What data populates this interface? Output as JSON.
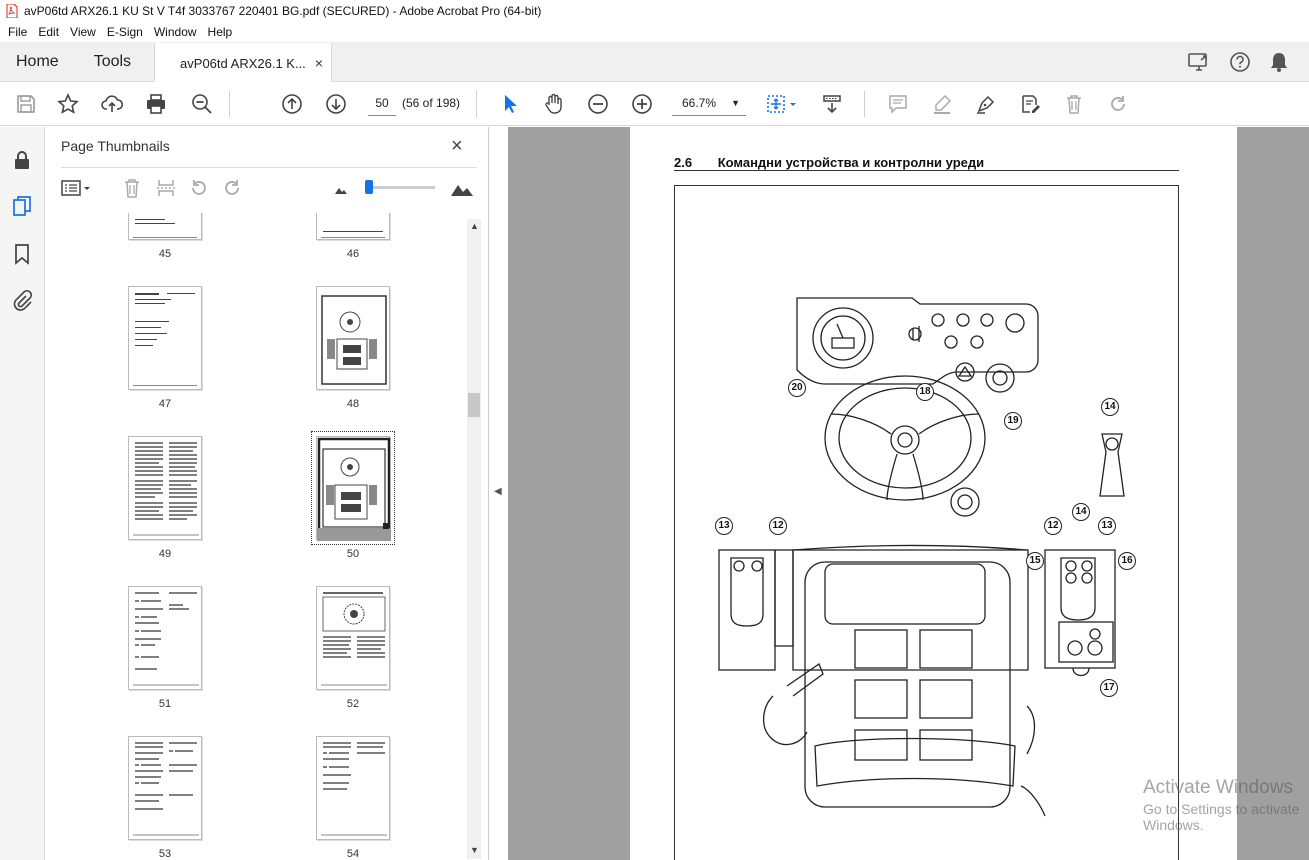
{
  "window": {
    "title": "avP06td ARX26.1 KU St V T4f 3033767 220401 BG.pdf (SECURED) - Adobe Acrobat Pro (64-bit)"
  },
  "menu": [
    "File",
    "Edit",
    "View",
    "E-Sign",
    "Window",
    "Help"
  ],
  "tabs": {
    "home": "Home",
    "tools": "Tools",
    "doc": "avP06td ARX26.1 K...",
    "close": "×"
  },
  "toolbar": {
    "page_value": "50",
    "page_count": "(56 of 198)",
    "zoom": "66.7%"
  },
  "panel": {
    "title": "Page Thumbnails",
    "close": "×",
    "thumbnails": [
      {
        "label": "45"
      },
      {
        "label": "46"
      },
      {
        "label": "47"
      },
      {
        "label": "48"
      },
      {
        "label": "49"
      },
      {
        "label": "50",
        "selected": true
      },
      {
        "label": "51"
      },
      {
        "label": "52"
      },
      {
        "label": "53"
      },
      {
        "label": "54"
      }
    ]
  },
  "document": {
    "section_number": "2.6",
    "section_title": "Командни устройства и контролни уреди",
    "callouts": [
      "20",
      "18",
      "19",
      "14",
      "13",
      "12",
      "12",
      "14",
      "13",
      "15",
      "16",
      "17"
    ]
  },
  "watermark": {
    "line1": "Activate Windows",
    "line2": "Go to Settings to activate Windows."
  },
  "colors": {
    "accent": "#1473e6",
    "pdf_red": "#d9241a",
    "doc_bg": "#a0a0a0"
  }
}
